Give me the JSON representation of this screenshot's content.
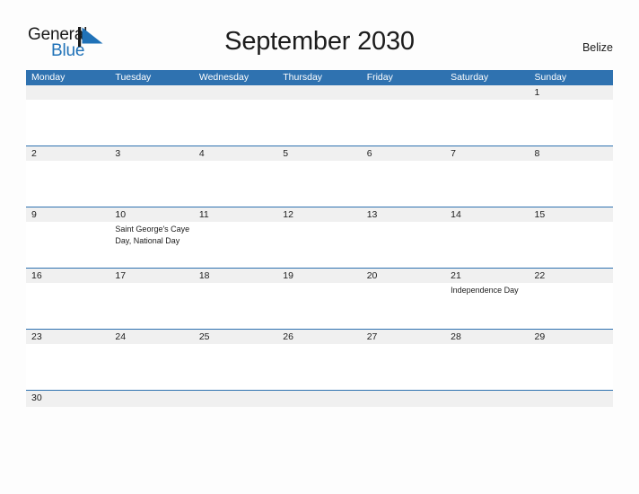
{
  "brand": {
    "name_part1": "General",
    "name_part2": "Blue",
    "mark": "flag-triangle-logo",
    "accent_color": "#2072b8"
  },
  "header": {
    "title": "September 2030",
    "region": "Belize"
  },
  "calendar": {
    "header_color": "#2f72b0",
    "band_color": "#f0f0f0",
    "separator_color": "#2f72b0",
    "weekday_headers": [
      "Monday",
      "Tuesday",
      "Wednesday",
      "Thursday",
      "Friday",
      "Saturday",
      "Sunday"
    ],
    "weeks": [
      {
        "days": [
          {
            "num": "",
            "event": ""
          },
          {
            "num": "",
            "event": ""
          },
          {
            "num": "",
            "event": ""
          },
          {
            "num": "",
            "event": ""
          },
          {
            "num": "",
            "event": ""
          },
          {
            "num": "",
            "event": ""
          },
          {
            "num": "1",
            "event": ""
          }
        ]
      },
      {
        "days": [
          {
            "num": "2",
            "event": ""
          },
          {
            "num": "3",
            "event": ""
          },
          {
            "num": "4",
            "event": ""
          },
          {
            "num": "5",
            "event": ""
          },
          {
            "num": "6",
            "event": ""
          },
          {
            "num": "7",
            "event": ""
          },
          {
            "num": "8",
            "event": ""
          }
        ]
      },
      {
        "days": [
          {
            "num": "9",
            "event": ""
          },
          {
            "num": "10",
            "event": "Saint George's Caye Day, National Day"
          },
          {
            "num": "11",
            "event": ""
          },
          {
            "num": "12",
            "event": ""
          },
          {
            "num": "13",
            "event": ""
          },
          {
            "num": "14",
            "event": ""
          },
          {
            "num": "15",
            "event": ""
          }
        ]
      },
      {
        "days": [
          {
            "num": "16",
            "event": ""
          },
          {
            "num": "17",
            "event": ""
          },
          {
            "num": "18",
            "event": ""
          },
          {
            "num": "19",
            "event": ""
          },
          {
            "num": "20",
            "event": ""
          },
          {
            "num": "21",
            "event": "Independence Day"
          },
          {
            "num": "22",
            "event": ""
          }
        ]
      },
      {
        "days": [
          {
            "num": "23",
            "event": ""
          },
          {
            "num": "24",
            "event": ""
          },
          {
            "num": "25",
            "event": ""
          },
          {
            "num": "26",
            "event": ""
          },
          {
            "num": "27",
            "event": ""
          },
          {
            "num": "28",
            "event": ""
          },
          {
            "num": "29",
            "event": ""
          }
        ]
      },
      {
        "last": true,
        "days": [
          {
            "num": "30",
            "event": ""
          },
          {
            "num": "",
            "event": ""
          },
          {
            "num": "",
            "event": ""
          },
          {
            "num": "",
            "event": ""
          },
          {
            "num": "",
            "event": ""
          },
          {
            "num": "",
            "event": ""
          },
          {
            "num": "",
            "event": ""
          }
        ]
      }
    ]
  }
}
